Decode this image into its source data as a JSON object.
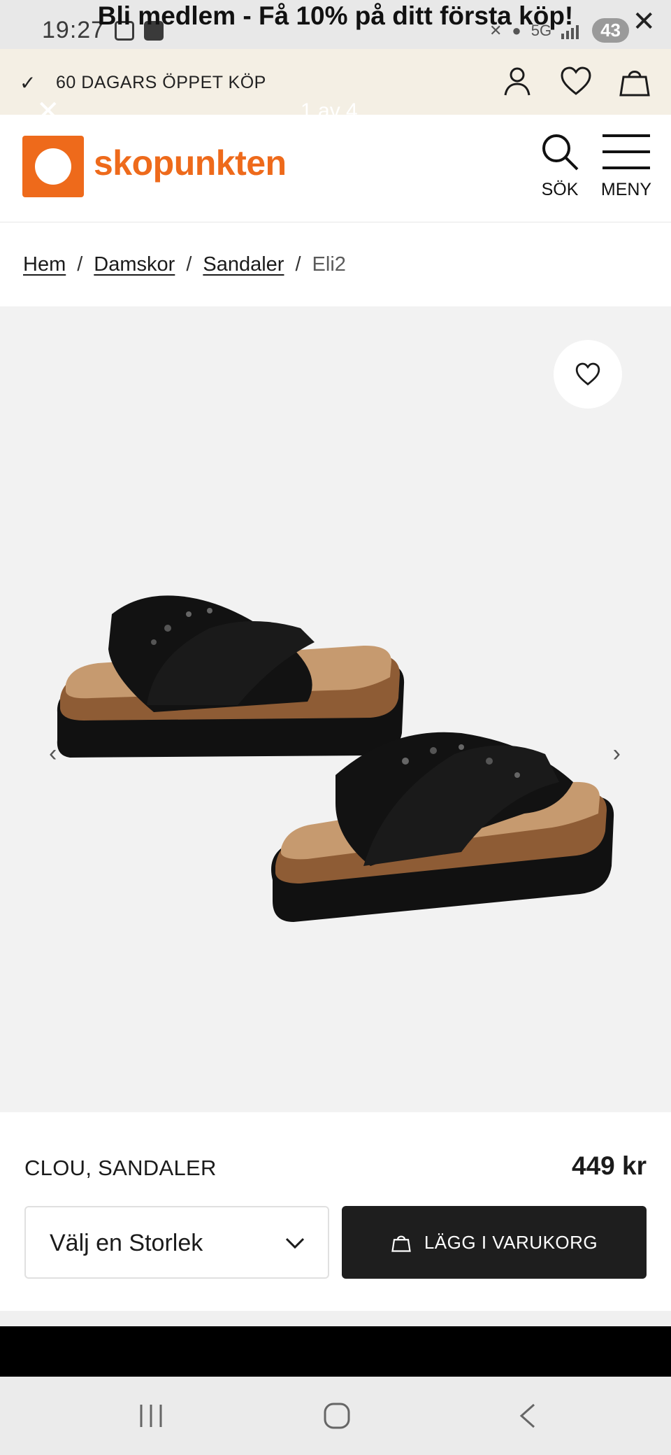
{
  "status_bar": {
    "time": "19:27",
    "network": "5G",
    "battery": "43"
  },
  "promo_banner": {
    "text": "Bli medlem - Få 10% på ditt första köp!"
  },
  "utility": {
    "open_purchase": "60 DAGARS ÖPPET KÖP",
    "gallery_counter": "1 av 4"
  },
  "header": {
    "logo_text": "skopunkten",
    "search_label": "SÖK",
    "menu_label": "MENY"
  },
  "breadcrumb": {
    "items": [
      "Hem",
      "Damskor",
      "Sandaler"
    ],
    "current": "Eli2"
  },
  "product": {
    "name": "CLOU, SANDALER",
    "price": "449 kr",
    "size_placeholder": "Välj en Storlek",
    "add_to_cart": "LÄGG I VARUKORG"
  },
  "icons": {
    "check": "check-icon",
    "account": "user-icon",
    "wishlist": "heart-icon",
    "bag": "shopping-bag-icon",
    "search": "search-icon",
    "menu": "hamburger-menu-icon",
    "close": "close-icon",
    "prev": "chevron-left-icon",
    "next": "chevron-right-icon"
  },
  "colors": {
    "brand": "#ee6a1b",
    "cta": "#1e1e1e",
    "strip": "#f4efe4"
  }
}
